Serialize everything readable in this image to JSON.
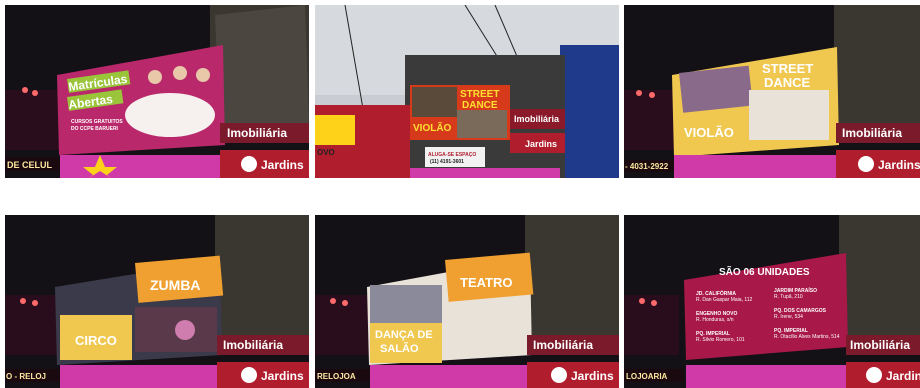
{
  "photos": [
    {
      "id": "p1",
      "screen_lines": [
        "Matrículas",
        "Abertas"
      ],
      "screen_small": [
        "CURSOS GRATUITOS",
        "DO CCPE BARUERI"
      ],
      "store_sign": "Imobiliária",
      "store_sign2": "Jardins",
      "left_sign": "DE CELUL"
    },
    {
      "id": "p2",
      "screen_lines": [
        "STREET",
        "DANCE",
        "VIOLÃO"
      ],
      "store_sign": "Imobiliária",
      "store_sign2": "Jardins",
      "banner": "ALUGA-SE ESPAÇO",
      "banner2": "(11) 4191-3601",
      "left_sign": "OVO"
    },
    {
      "id": "p3",
      "screen_lines": [
        "STREET",
        "DANCE",
        "VIOLÃO"
      ],
      "store_sign": "Imobiliária",
      "store_sign2": "Jardins",
      "left_sign": "- 4031-2922"
    },
    {
      "id": "p4",
      "screen_lines": [
        "ZUMBA",
        "CIRCO"
      ],
      "store_sign": "Imobiliária",
      "store_sign2": "Jardins",
      "left_sign": "O - RELOJ"
    },
    {
      "id": "p5",
      "screen_lines": [
        "TEATRO",
        "DANÇA DE",
        "SALÃO"
      ],
      "store_sign": "Imobiliária",
      "store_sign2": "Jardins",
      "left_sign": "RELOJOA"
    },
    {
      "id": "p6",
      "screen_title": "SÃO 06 UNIDADES",
      "units": [
        {
          "name": "JD. CALIFÓRNIA",
          "addr": "R. Dan Gaspar Maia, 112"
        },
        {
          "name": "JARDIM PARAÍSO",
          "addr": "R. Tupã, 210"
        },
        {
          "name": "ENGENHO NOVO",
          "addr": "R. Honduras, s/n"
        },
        {
          "name": "PQ. DOS CAMARGOS",
          "addr": "R. Irene, 534"
        },
        {
          "name": "PQ. IMPERIAL",
          "addr": "R. Silvio Romero, 101"
        },
        {
          "name": "PQ. IMPERIAL",
          "addr": "R. Otacílio Alves Martins, 514"
        }
      ],
      "store_sign": "Imobiliária",
      "store_sign2": "Jardins",
      "left_sign": "LOJOARIA"
    }
  ]
}
